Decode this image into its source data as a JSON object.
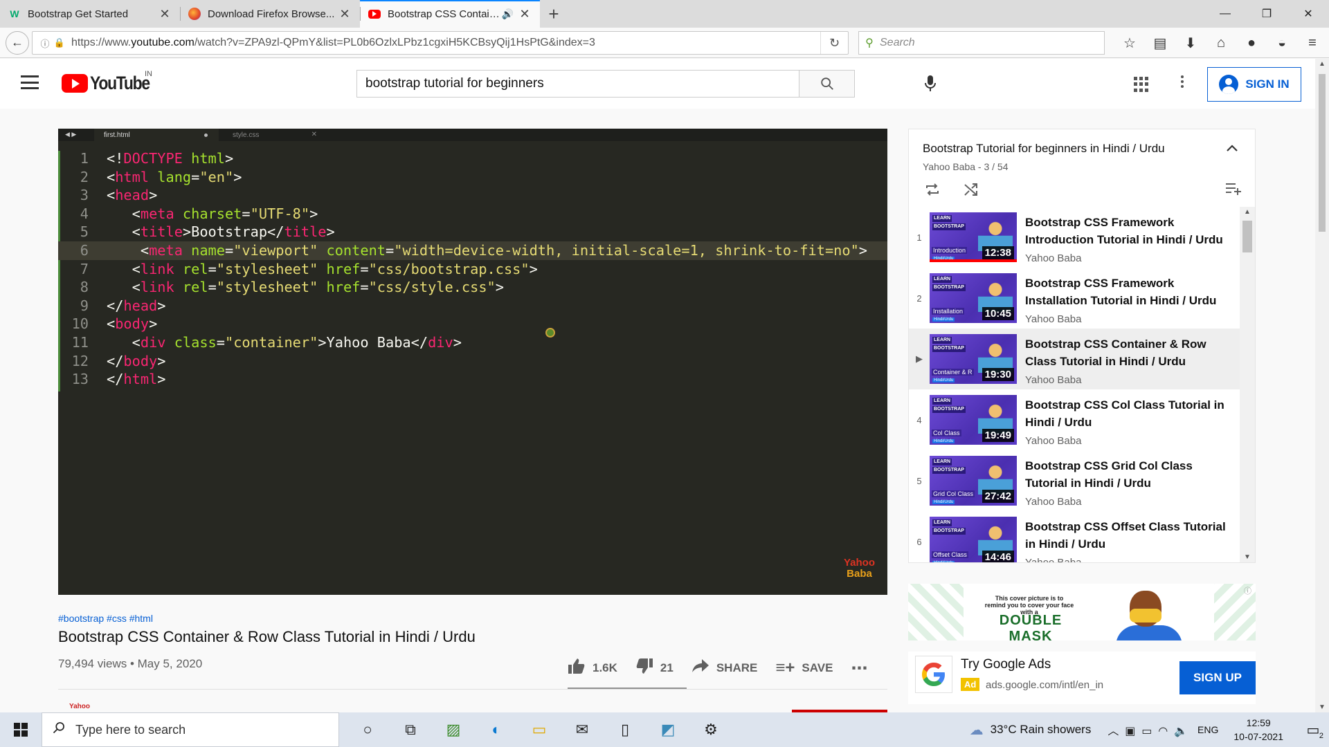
{
  "browser": {
    "tabs": [
      {
        "title": "Bootstrap Get Started",
        "favicon": "w3schools-icon",
        "active": false
      },
      {
        "title": "Download Firefox Browse...",
        "favicon": "firefox-icon",
        "active": false
      },
      {
        "title": "Bootstrap CSS Contain...",
        "favicon": "youtube-icon",
        "active": true,
        "audio": true
      }
    ],
    "url_prefix": "https://www.",
    "url_domain": "youtube.com",
    "url_rest": "/watch?v=ZPA9zl-QPmY&list=PL0b6OzlxLPbz1cgxiH5KCBsyQij1HsPtG&index=3",
    "search_placeholder": "Search"
  },
  "youtube": {
    "country": "IN",
    "search_query": "bootstrap tutorial for beginners",
    "sign_in": "SIGN IN"
  },
  "editor": {
    "tab_active": "first.html",
    "tab_other": "style.css",
    "highlighted_line": 6,
    "lines": [
      {
        "n": "1",
        "indent": "",
        "parts": [
          [
            "pl",
            "<!"
          ],
          [
            "tg",
            "DOCTYPE"
          ],
          [
            "pl",
            " "
          ],
          [
            "at",
            "html"
          ],
          [
            "pl",
            ">"
          ]
        ]
      },
      {
        "n": "2",
        "indent": "",
        "parts": [
          [
            "pl",
            "<"
          ],
          [
            "tg",
            "html"
          ],
          [
            "pl",
            " "
          ],
          [
            "at",
            "lang"
          ],
          [
            "pl",
            "="
          ],
          [
            "st",
            "\"en\""
          ],
          [
            "pl",
            ">"
          ]
        ]
      },
      {
        "n": "3",
        "indent": "",
        "parts": [
          [
            "pl",
            "<"
          ],
          [
            "tg",
            "head"
          ],
          [
            "pl",
            ">"
          ]
        ]
      },
      {
        "n": "4",
        "indent": "   ",
        "parts": [
          [
            "pl",
            "<"
          ],
          [
            "tg",
            "meta"
          ],
          [
            "pl",
            " "
          ],
          [
            "at",
            "charset"
          ],
          [
            "pl",
            "="
          ],
          [
            "st",
            "\"UTF-8\""
          ],
          [
            "pl",
            ">"
          ]
        ]
      },
      {
        "n": "5",
        "indent": "   ",
        "parts": [
          [
            "pl",
            "<"
          ],
          [
            "tg",
            "title"
          ],
          [
            "pl",
            ">Bootstrap</"
          ],
          [
            "tg",
            "title"
          ],
          [
            "pl",
            ">"
          ]
        ]
      },
      {
        "n": "6",
        "indent": "    ",
        "parts": [
          [
            "pl",
            "<"
          ],
          [
            "tg",
            "meta"
          ],
          [
            "pl",
            " "
          ],
          [
            "at",
            "name"
          ],
          [
            "pl",
            "="
          ],
          [
            "st",
            "\"viewport\""
          ],
          [
            "pl",
            " "
          ],
          [
            "at",
            "content"
          ],
          [
            "pl",
            "="
          ],
          [
            "st",
            "\"width=device-width, initial-scale=1, shrink-to-fit=no\""
          ],
          [
            "pl",
            ">"
          ]
        ]
      },
      {
        "n": "7",
        "indent": "   ",
        "parts": [
          [
            "pl",
            "<"
          ],
          [
            "tg",
            "link"
          ],
          [
            "pl",
            " "
          ],
          [
            "at",
            "rel"
          ],
          [
            "pl",
            "="
          ],
          [
            "st",
            "\"stylesheet\""
          ],
          [
            "pl",
            " "
          ],
          [
            "at",
            "href"
          ],
          [
            "pl",
            "="
          ],
          [
            "st",
            "\"css/bootstrap.css\""
          ],
          [
            "pl",
            ">"
          ]
        ]
      },
      {
        "n": "8",
        "indent": "   ",
        "parts": [
          [
            "pl",
            "<"
          ],
          [
            "tg",
            "link"
          ],
          [
            "pl",
            " "
          ],
          [
            "at",
            "rel"
          ],
          [
            "pl",
            "="
          ],
          [
            "st",
            "\"stylesheet\""
          ],
          [
            "pl",
            " "
          ],
          [
            "at",
            "href"
          ],
          [
            "pl",
            "="
          ],
          [
            "st",
            "\"css/style.css\""
          ],
          [
            "pl",
            ">"
          ]
        ]
      },
      {
        "n": "9",
        "indent": "",
        "parts": [
          [
            "pl",
            "</"
          ],
          [
            "tg",
            "head"
          ],
          [
            "pl",
            ">"
          ]
        ]
      },
      {
        "n": "10",
        "indent": "",
        "parts": [
          [
            "pl",
            "<"
          ],
          [
            "tg",
            "body"
          ],
          [
            "pl",
            ">"
          ]
        ]
      },
      {
        "n": "11",
        "indent": "   ",
        "parts": [
          [
            "pl",
            "<"
          ],
          [
            "tg",
            "div"
          ],
          [
            "pl",
            " "
          ],
          [
            "at",
            "class"
          ],
          [
            "pl",
            "="
          ],
          [
            "st",
            "\"container\""
          ],
          [
            "pl",
            ">Yahoo Baba</"
          ],
          [
            "tg",
            "div"
          ],
          [
            "pl",
            ">"
          ]
        ]
      },
      {
        "n": "12",
        "indent": "",
        "parts": [
          [
            "pl",
            "</"
          ],
          [
            "tg",
            "body"
          ],
          [
            "pl",
            ">"
          ]
        ]
      },
      {
        "n": "13",
        "indent": "",
        "parts": [
          [
            "pl",
            "</"
          ],
          [
            "tg",
            "html"
          ],
          [
            "pl",
            ">"
          ]
        ]
      }
    ],
    "watermark_top": "Yahoo",
    "watermark_bottom": "Baba"
  },
  "video": {
    "hashtags": "#bootstrap #css #html",
    "title": "Bootstrap CSS Container & Row Class Tutorial in Hindi / Urdu",
    "views_date": "79,494 views • May 5, 2020",
    "likes": "1.6K",
    "dislikes": "21",
    "share": "SHARE",
    "save": "SAVE",
    "channel_logo_text": "Yahoo"
  },
  "playlist": {
    "title": "Bootstrap Tutorial for beginners in Hindi / Urdu",
    "subtitle": "Yahoo Baba - 3 / 54",
    "items": [
      {
        "index": "1",
        "title": "Bootstrap CSS Framework Introduction Tutorial in Hindi / Urdu",
        "channel": "Yahoo Baba",
        "duration": "12:38",
        "topic": "Introduction",
        "watched": 1.0
      },
      {
        "index": "2",
        "title": "Bootstrap CSS Framework Installation Tutorial in Hindi / Urdu",
        "channel": "Yahoo Baba",
        "duration": "10:45",
        "topic": "Installation",
        "watched": 0
      },
      {
        "index": "▶",
        "title": "Bootstrap CSS Container & Row Class Tutorial in Hindi / Urdu",
        "channel": "Yahoo Baba",
        "duration": "19:30",
        "topic": "Container & R",
        "watched": 0,
        "current": true
      },
      {
        "index": "4",
        "title": "Bootstrap CSS Col Class Tutorial in Hindi / Urdu",
        "channel": "Yahoo Baba",
        "duration": "19:49",
        "topic": "Col Class",
        "watched": 0
      },
      {
        "index": "5",
        "title": "Bootstrap CSS Grid Col Class Tutorial in Hindi / Urdu",
        "channel": "Yahoo Baba",
        "duration": "27:42",
        "topic": "Grid Col Class",
        "watched": 0
      },
      {
        "index": "6",
        "title": "Bootstrap CSS Offset Class Tutorial in Hindi / Urdu",
        "channel": "Yahoo Baba",
        "duration": "14:46",
        "topic": "Offset Class",
        "watched": 0
      }
    ],
    "thumb_learn": "LEARN",
    "thumb_brand": "BOOTSTRAP",
    "thumb_lang": "Hindi/Urdu"
  },
  "ads": {
    "banner_message": "This cover picture is to remind you to cover your face with a",
    "banner_headline": "DOUBLE MASK",
    "card_title": "Try Google Ads",
    "card_badge": "Ad",
    "card_url": "ads.google.com/intl/en_in",
    "card_button": "SIGN UP"
  },
  "taskbar": {
    "search_placeholder": "Type here to search",
    "weather": "33°C  Rain showers",
    "lang": "ENG",
    "time": "12:59",
    "date": "10-07-2021",
    "notifications": "2"
  }
}
